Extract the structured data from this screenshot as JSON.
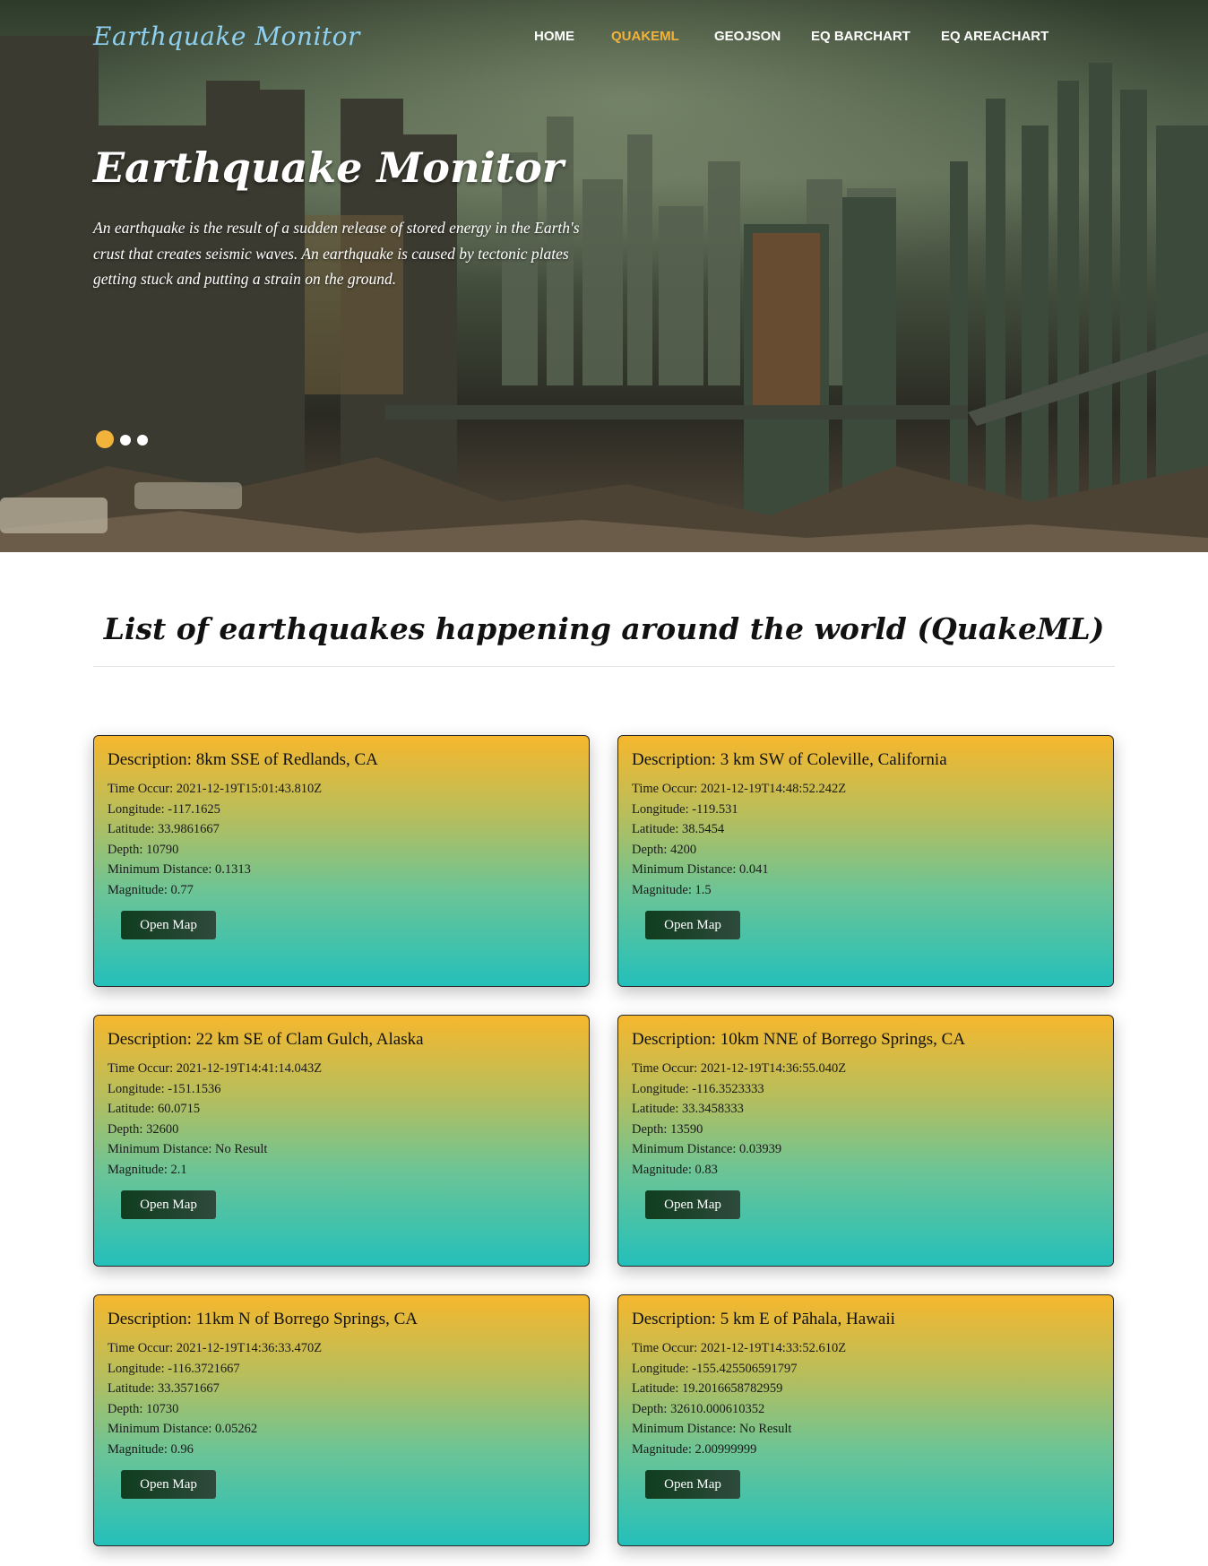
{
  "header": {
    "logo": "Earthquake Monitor",
    "nav": [
      {
        "label": "HOME",
        "active": false
      },
      {
        "label": "QUAKEML",
        "active": true
      },
      {
        "label": "GEOJSON",
        "active": false
      },
      {
        "label": "EQ BARCHART",
        "active": false
      },
      {
        "label": "EQ AREACHART",
        "active": false
      }
    ]
  },
  "hero": {
    "title": "Earthquake Monitor",
    "text": "An earthquake is the result of a sudden release of stored energy in the Earth's crust that creates seismic waves. An earthquake is caused by tectonic plates getting stuck and putting a strain on the ground.",
    "slides": 3,
    "active_slide": 1
  },
  "section": {
    "title": "List of earthquakes happening around the world (QuakeML)"
  },
  "colors": {
    "accent": "#f2b33a",
    "card_top": "#f6b72d",
    "card_bottom": "#24c0bb",
    "button": "#0f3d1f"
  },
  "labels": {
    "description": "Description:",
    "time": "Time Occur:",
    "longitude": "Longitude:",
    "latitude": "Latitude:",
    "depth": "Depth:",
    "min_distance": "Minimum Distance:",
    "magnitude": "Magnitude:",
    "button": "Open Map"
  },
  "earthquakes": [
    {
      "description": "8km SSE of Redlands, CA",
      "time": "2021-12-19T15:01:43.810Z",
      "longitude": "-117.1625",
      "latitude": "33.9861667",
      "depth": "10790",
      "min_distance": "0.1313",
      "magnitude": "0.77"
    },
    {
      "description": "3 km SW of Coleville, California",
      "time": "2021-12-19T14:48:52.242Z",
      "longitude": "-119.531",
      "latitude": "38.5454",
      "depth": "4200",
      "min_distance": "0.041",
      "magnitude": "1.5"
    },
    {
      "description": "22 km SE of Clam Gulch, Alaska",
      "time": "2021-12-19T14:41:14.043Z",
      "longitude": "-151.1536",
      "latitude": "60.0715",
      "depth": "32600",
      "min_distance": "No Result",
      "magnitude": "2.1"
    },
    {
      "description": "10km NNE of Borrego Springs, CA",
      "time": "2021-12-19T14:36:55.040Z",
      "longitude": "-116.3523333",
      "latitude": "33.3458333",
      "depth": "13590",
      "min_distance": "0.03939",
      "magnitude": "0.83"
    },
    {
      "description": "11km N of Borrego Springs, CA",
      "time": "2021-12-19T14:36:33.470Z",
      "longitude": "-116.3721667",
      "latitude": "33.3571667",
      "depth": "10730",
      "min_distance": "0.05262",
      "magnitude": "0.96"
    },
    {
      "description": "5 km E of Pāhala, Hawaii",
      "time": "2021-12-19T14:33:52.610Z",
      "longitude": "-155.425506591797",
      "latitude": "19.2016658782959",
      "depth": "32610.000610352",
      "min_distance": "No Result",
      "magnitude": "2.00999999"
    }
  ]
}
